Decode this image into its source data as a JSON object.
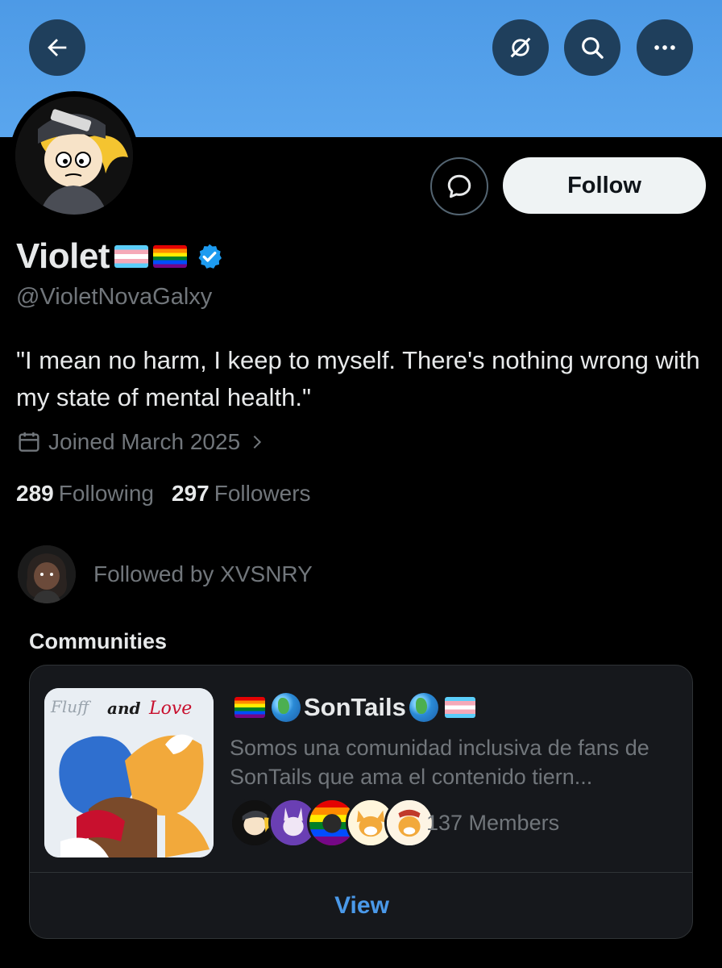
{
  "header": {
    "back_icon": "arrow-left-icon",
    "grok_icon": "grok-slash-icon",
    "search_icon": "search-icon",
    "more_icon": "more-horizontal-icon",
    "banner_color": "#5aa6ee"
  },
  "profile": {
    "name": "Violet",
    "handle": "@VioletNovaGalxy",
    "verified": true,
    "flags": [
      "transgender-flag",
      "rainbow-flag"
    ],
    "bio": "\"I mean no harm, I keep to myself. There's nothing wrong with my state of mental health.\"",
    "joined": "Joined March 2025",
    "following_count": "289",
    "following_label": "Following",
    "followers_count": "297",
    "followers_label": "Followers",
    "followed_by": "Followed by XVSNRY"
  },
  "actions": {
    "message_icon": "message-bubble-icon",
    "follow_label": "Follow"
  },
  "communities": {
    "section_label": "Communities",
    "card": {
      "name": "SonTails",
      "thumbnail_caption_1": "Fluff",
      "thumbnail_caption_2": "and",
      "thumbnail_caption_3": "Love",
      "description": "Somos una comunidad inclusiva de fans de SonTails que ama el contenido tiern...",
      "members": "137 Members",
      "view_label": "View"
    }
  },
  "colors": {
    "accent": "#4a99e9",
    "verified": "#1d9bf0",
    "muted": "#71767b"
  }
}
